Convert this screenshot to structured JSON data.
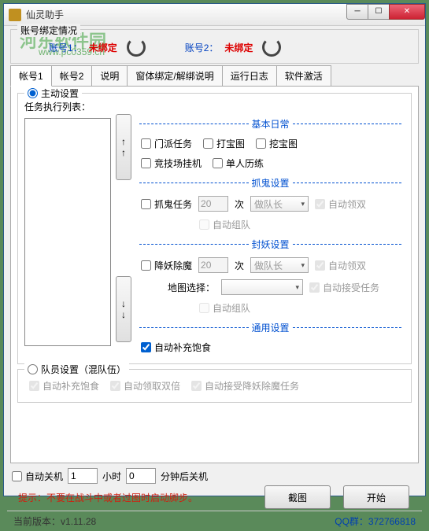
{
  "window": {
    "title": "仙灵助手"
  },
  "watermark": {
    "text": "河东软件园",
    "url": "www.pc0359.cn"
  },
  "bindGroup": {
    "title": "账号绑定情况",
    "acc1_label": "账号1：",
    "acc1_status": "未绑定",
    "acc2_label": "账号2：",
    "acc2_status": "未绑定"
  },
  "tabs": [
    "帐号1",
    "帐号2",
    "说明",
    "窗体绑定/解绑说明",
    "运行日志",
    "软件激活"
  ],
  "activeGroup": {
    "radio_label": "主动设置",
    "task_list_label": "任务执行列表：",
    "sections": {
      "basic": "基本日常",
      "ghost": "抓鬼设置",
      "demon": "封妖设置",
      "general": "通用设置"
    },
    "basic": {
      "menpai": "门派任务",
      "dabaotu": "打宝图",
      "wabaotu": "挖宝图",
      "jingji": "竞技场挂机",
      "danren": "单人历练"
    },
    "ghost": {
      "task": "抓鬼任务",
      "count": "20",
      "times": "次",
      "leader": "做队长",
      "auto_double": "自动领双",
      "auto_team": "自动组队"
    },
    "demon": {
      "task": "降妖除魔",
      "count": "20",
      "times": "次",
      "leader": "做队长",
      "auto_double": "自动领双",
      "map_label": "地图选择：",
      "map_value": "",
      "auto_accept": "自动接受任务",
      "auto_team": "自动组队"
    },
    "general": {
      "auto_food": "自动补充饱食"
    }
  },
  "memberGroup": {
    "radio_label": "队员设置（混队伍）",
    "auto_food": "自动补充饱食",
    "auto_double": "自动领取双倍",
    "auto_accept": "自动接受降妖除魔任务"
  },
  "shutdown": {
    "auto": "自动关机",
    "hours_val": "1",
    "hours": "小时",
    "mins_val": "0",
    "mins": "分钟后关机"
  },
  "tip": "提示：不要在战斗中或者过图时启动脚步。",
  "buttons": {
    "screenshot": "截图",
    "start": "开始"
  },
  "footer": {
    "version_label": "当前版本：",
    "version": "v1.11.28",
    "qq_label": "QQ群：",
    "qq": "372766818"
  }
}
